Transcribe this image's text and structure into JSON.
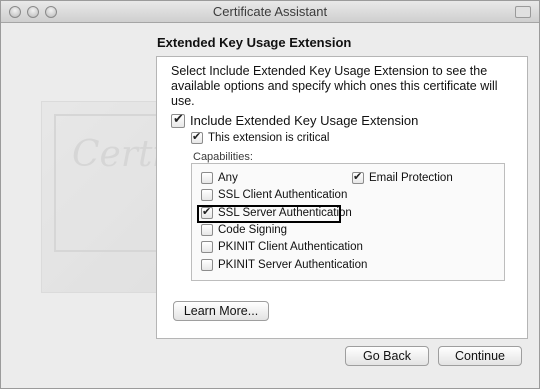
{
  "window": {
    "title": "Certificate Assistant"
  },
  "heading": "Extended Key Usage Extension",
  "instruction": "Select Include Extended Key Usage Extension to see the available options and specify which ones this certificate will use.",
  "include": {
    "label": "Include Extended Key Usage Extension",
    "checked": true
  },
  "critical": {
    "label": "This extension is critical",
    "checked": true
  },
  "capabilities": {
    "label": "Capabilities:",
    "items": [
      {
        "label": "Any",
        "checked": false
      },
      {
        "label": "Email Protection",
        "checked": true
      },
      {
        "label": "SSL Client Authentication",
        "checked": false
      },
      {
        "label": "SSL Server Authentication",
        "checked": true
      },
      {
        "label": "Code Signing",
        "checked": false
      },
      {
        "label": "PKINIT Client Authentication",
        "checked": false
      },
      {
        "label": "PKINIT Server Authentication",
        "checked": false
      }
    ]
  },
  "buttons": {
    "learn_more": "Learn More...",
    "go_back": "Go Back",
    "continue": "Continue"
  }
}
